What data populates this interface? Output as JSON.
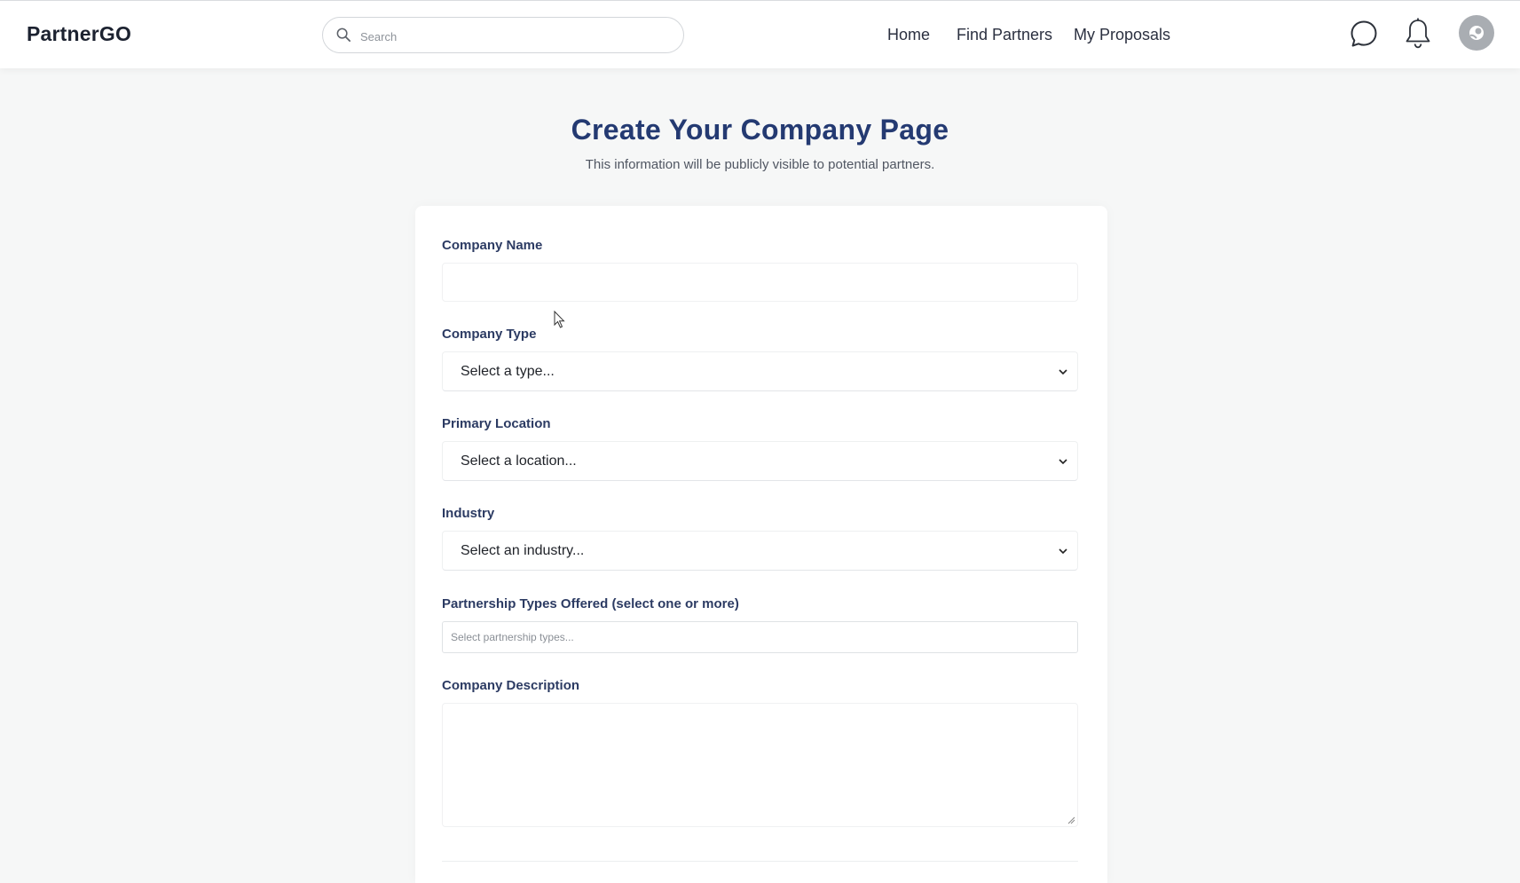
{
  "app": {
    "name": "PartnerGO"
  },
  "header": {
    "search": {
      "placeholder": "Search",
      "icon": "search-icon"
    },
    "nav": [
      {
        "label": "Home"
      },
      {
        "label": "Find Partners"
      },
      {
        "label": "My Proposals"
      }
    ],
    "icons": [
      "chat-icon",
      "bell-icon",
      "avatar"
    ]
  },
  "page": {
    "title": "Create Your Company Page",
    "subtitle": "This information will be publicly visible to potential partners."
  },
  "form": {
    "company_name": {
      "label": "Company Name",
      "value": ""
    },
    "company_type": {
      "label": "Company Type",
      "selected": "Select a type..."
    },
    "primary_location": {
      "label": "Primary Location",
      "selected": "Select a location..."
    },
    "industry": {
      "label": "Industry",
      "selected": "Select an industry..."
    },
    "partnership_types": {
      "label": "Partnership Types Offered (select one or more)",
      "placeholder": "Select partnership types..."
    },
    "company_description": {
      "label": "Company Description",
      "value": ""
    }
  },
  "colors": {
    "title": "#243a72",
    "label": "#2c3b63",
    "background": "#f6f7f7",
    "card": "#ffffff"
  }
}
